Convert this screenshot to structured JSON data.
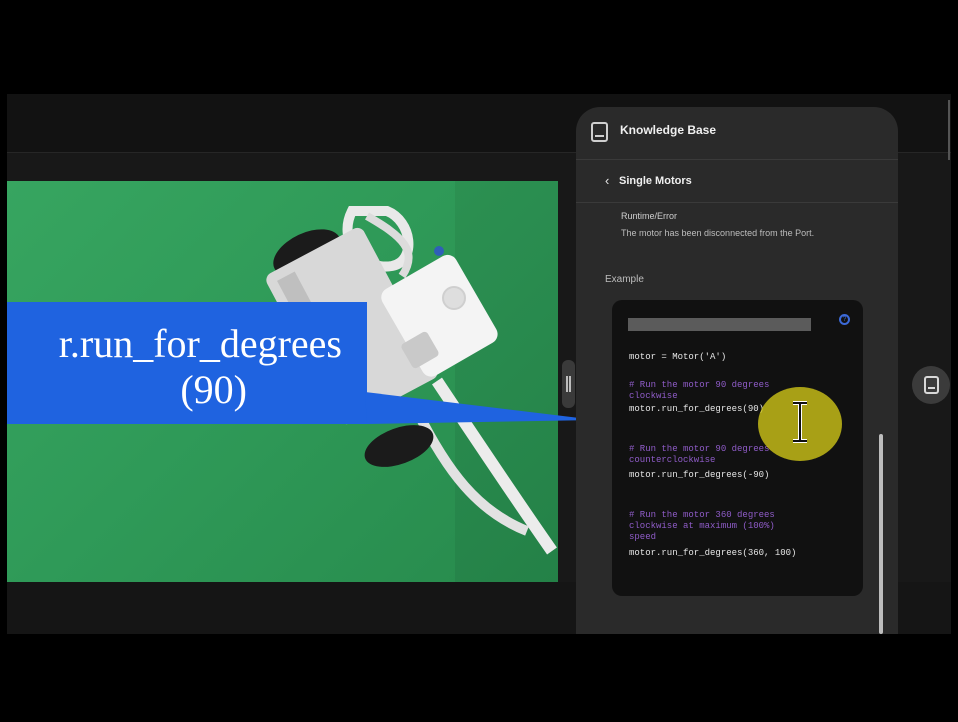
{
  "caption": {
    "line1": "r.run_for_degrees",
    "line2": "(90)"
  },
  "knowledge_base": {
    "title": "Knowledge Base",
    "back_label": "Single Motors",
    "error_name": "Runtime/Error",
    "error_description": "The motor has been disconnected from the Port.",
    "example_heading": "Example",
    "code": {
      "line_constructor": "motor = Motor('A')",
      "comment_1a": "# Run the motor 90 degrees",
      "comment_1b": "clockwise",
      "call_1": "motor.run_for_degrees(90)",
      "comment_2a": "# Run the motor 90 degrees",
      "comment_2b": "counterclockwise",
      "call_2": "motor.run_for_degrees(-90)",
      "comment_3a": "# Run the motor 360 degrees",
      "comment_3b": "clockwise at maximum (100%)",
      "comment_3c": "speed",
      "call_3": "motor.run_for_degrees(360, 100)"
    }
  },
  "colors": {
    "caption_banner": "#1f63e0",
    "video_background": "#37a560",
    "cursor_highlight": "#cec418",
    "code_comment": "#8f5cc8",
    "panel_background": "#2a2a2a"
  },
  "icons": [
    "book-icon",
    "chevron-left-icon",
    "help-icon",
    "drag-handle-icon",
    "text-cursor-icon"
  ]
}
